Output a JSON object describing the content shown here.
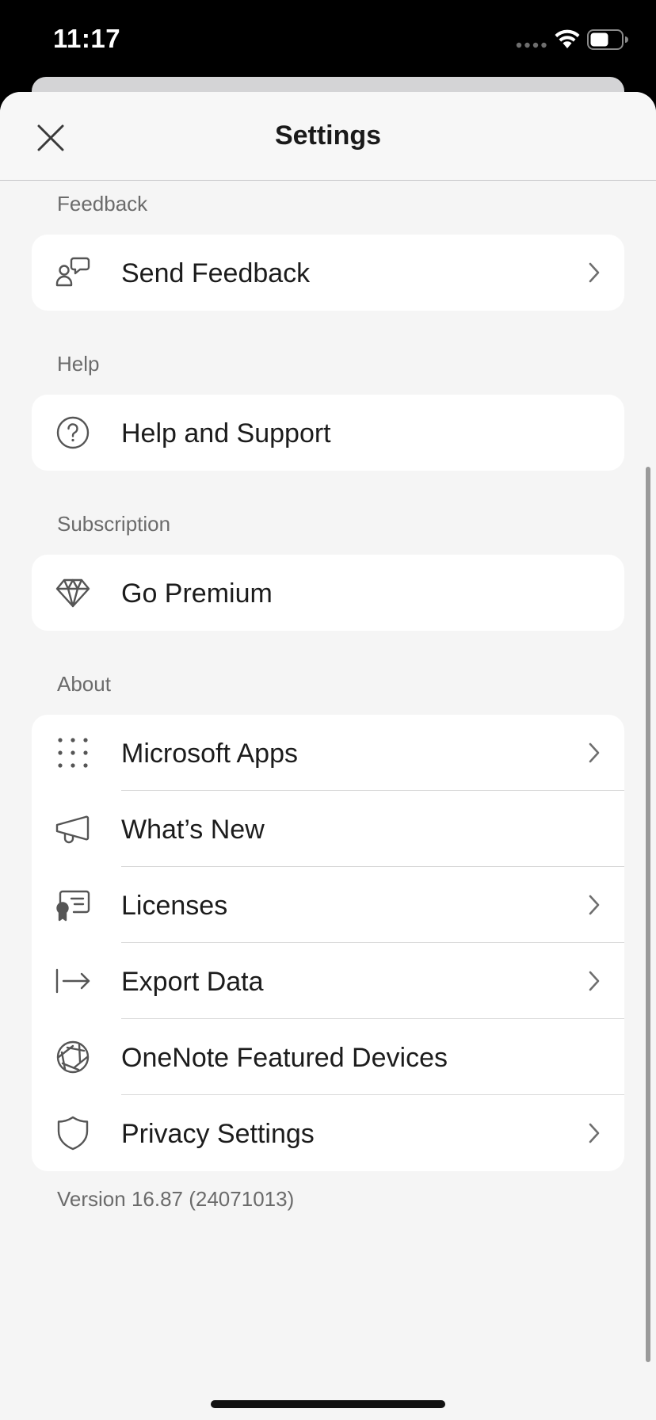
{
  "status_bar": {
    "time": "11:17"
  },
  "header": {
    "title": "Settings",
    "close_icon": "close-icon"
  },
  "sections": {
    "feedback": {
      "label": "Feedback",
      "items": [
        {
          "label": "Send Feedback",
          "icon": "feedback-icon",
          "chevron": true
        }
      ]
    },
    "help": {
      "label": "Help",
      "items": [
        {
          "label": "Help and Support",
          "icon": "question-circle-icon",
          "chevron": false
        }
      ]
    },
    "subscription": {
      "label": "Subscription",
      "items": [
        {
          "label": "Go Premium",
          "icon": "diamond-icon",
          "chevron": false
        }
      ]
    },
    "about": {
      "label": "About",
      "items": [
        {
          "label": "Microsoft Apps",
          "icon": "apps-grid-icon",
          "chevron": true
        },
        {
          "label": "What’s New",
          "icon": "megaphone-icon",
          "chevron": false
        },
        {
          "label": "Licenses",
          "icon": "certificate-icon",
          "chevron": true
        },
        {
          "label": "Export Data",
          "icon": "export-arrow-icon",
          "chevron": true
        },
        {
          "label": "OneNote Featured Devices",
          "icon": "aperture-icon",
          "chevron": false
        },
        {
          "label": "Privacy Settings",
          "icon": "shield-icon",
          "chevron": true
        }
      ]
    }
  },
  "version": "Version 16.87 (24071013)"
}
